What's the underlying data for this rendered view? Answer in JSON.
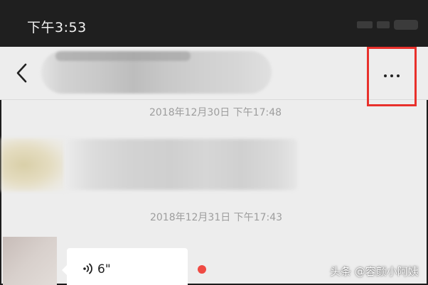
{
  "status_bar": {
    "time": "下午3:53"
  },
  "nav_bar": {
    "back_icon": "chevron-left-icon",
    "more_icon": "more-horizontal-icon",
    "highlight_color": "#e8302b"
  },
  "chat": {
    "timestamps": [
      "2018年12月30日 下午17:48",
      "2018年12月31日 下午17:43"
    ],
    "voice_message": {
      "icon": "voice-wave-icon",
      "duration": "6\"",
      "unread_color": "#ef4a43"
    }
  },
  "watermark": {
    "text": "头条 @容颜小阿姨"
  }
}
